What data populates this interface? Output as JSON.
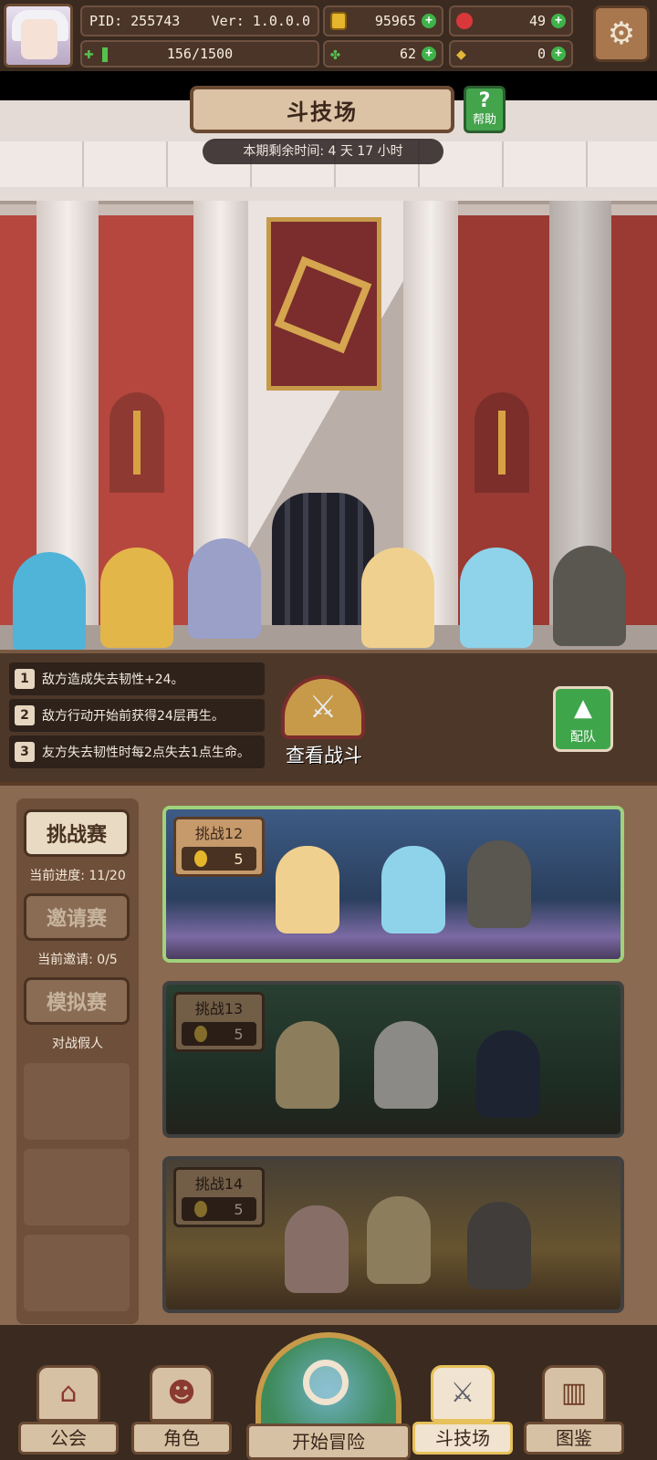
{
  "hud": {
    "pid": "PID: 255743",
    "version": "Ver: 1.0.0.0",
    "exp": "156/1500",
    "gold": "95965",
    "gems": "49",
    "clover": "62",
    "food": "0"
  },
  "arena": {
    "title": "斗技场",
    "help_label": "帮助",
    "help_glyph": "?",
    "timer": "本期剩余时间: 4 天 17 小时"
  },
  "modifiers": [
    {
      "num": "1",
      "text": "敌方造成失去韧性+24。"
    },
    {
      "num": "2",
      "text": "敌方行动开始前获得24层再生。"
    },
    {
      "num": "3",
      "text": "友方失去韧性时每2点失去1点生命。"
    }
  ],
  "view_battle": {
    "label": "查看战斗",
    "icon": "crossed-swords-icon"
  },
  "team_button": {
    "label": "配队"
  },
  "modes": [
    {
      "label": "挑战赛",
      "sub": "当前进度: 11/20",
      "active": true
    },
    {
      "label": "邀请赛",
      "sub": "当前邀请: 0/5",
      "active": false
    },
    {
      "label": "模拟赛",
      "sub": "对战假人",
      "active": false
    }
  ],
  "challenges": [
    {
      "name": "挑战12",
      "cost": "5"
    },
    {
      "name": "挑战13",
      "cost": "5"
    },
    {
      "name": "挑战14",
      "cost": "5"
    }
  ],
  "nav": {
    "guild": "公会",
    "character": "角色",
    "adventure": "开始冒险",
    "arena": "斗技场",
    "codex": "图鉴"
  },
  "colors": {
    "accent_green": "#3fb24a",
    "gold": "#e5b62b",
    "brown_dark": "#3a2a20"
  }
}
